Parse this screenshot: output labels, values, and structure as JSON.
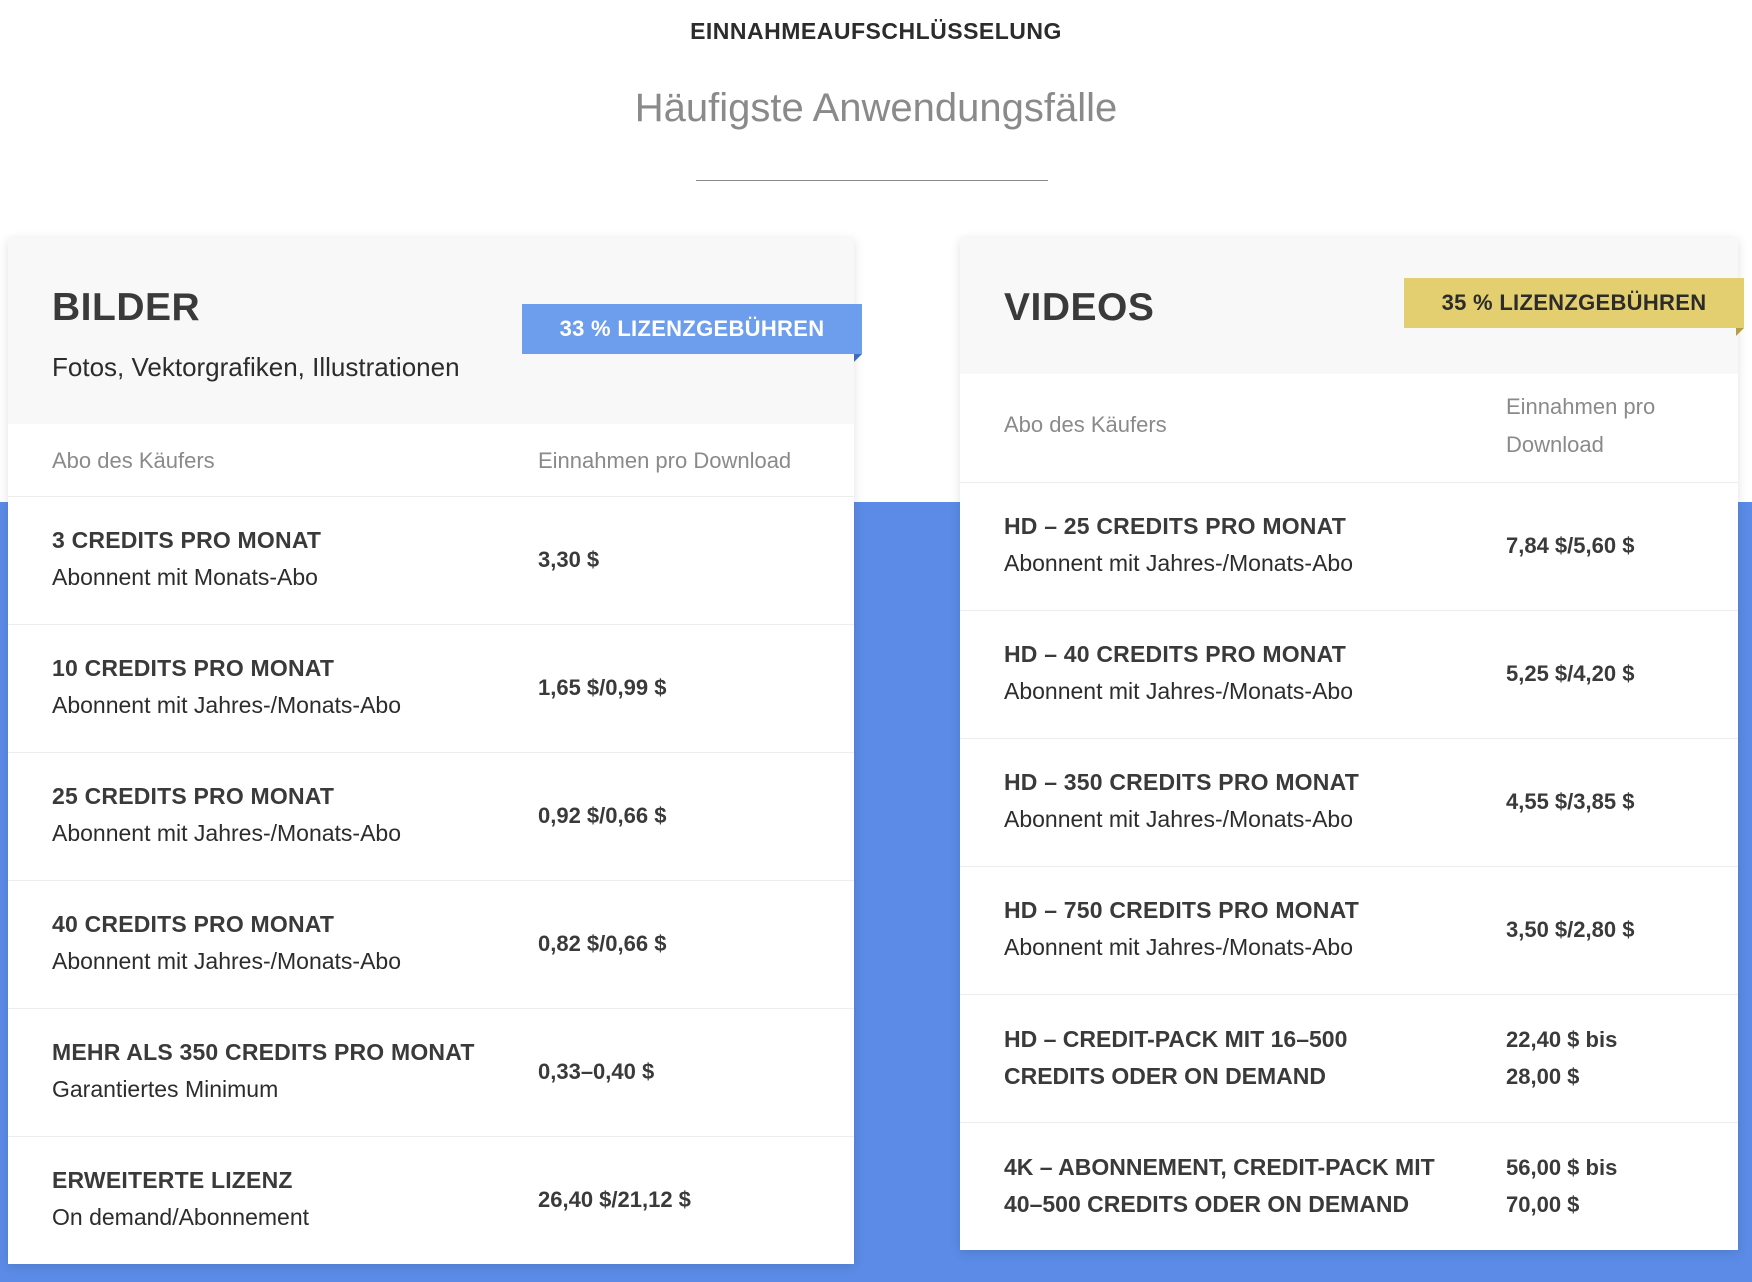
{
  "header": {
    "eyebrow": "EINNAHMEAUFSCHLÜSSELUNG",
    "title": "Häufigste Anwendungsfälle"
  },
  "colors": {
    "band": "#5b8be6",
    "badge_images": "#6d9eed",
    "badge_videos": "#e3cf6f"
  },
  "images": {
    "title": "BILDER",
    "subtitle": "Fotos, Vektorgrafiken, Illustrationen",
    "badge": "33 % LIZENZGEBÜHREN",
    "col_plan": "Abo des Käufers",
    "col_earnings": "Einnahmen pro Download",
    "rows": [
      {
        "name": "3 CREDITS PRO MONAT",
        "desc": "Abonnent mit Monats-Abo",
        "value": "3,30 $"
      },
      {
        "name": "10 CREDITS PRO MONAT",
        "desc": "Abonnent mit Jahres-/Monats-Abo",
        "value": "1,65 $/0,99 $"
      },
      {
        "name": "25 CREDITS PRO MONAT",
        "desc": "Abonnent mit Jahres-/Monats-Abo",
        "value": "0,92 $/0,66 $"
      },
      {
        "name": "40 CREDITS PRO MONAT",
        "desc": "Abonnent mit Jahres-/Monats-Abo",
        "value": "0,82 $/0,66 $"
      },
      {
        "name": "MEHR ALS 350 CREDITS PRO MONAT",
        "desc": "Garantiertes Minimum",
        "value": "0,33–0,40 $"
      },
      {
        "name": "ERWEITERTE LIZENZ",
        "desc": "On demand/Abonnement",
        "value": "26,40 $/21,12 $"
      }
    ]
  },
  "videos": {
    "title": "VIDEOS",
    "badge": "35 % LIZENZGEBÜHREN",
    "col_plan": "Abo des Käufers",
    "col_earnings_1": "Einnahmen pro",
    "col_earnings_2": "Download",
    "rows": [
      {
        "name": "HD – 25 CREDITS PRO MONAT",
        "desc": "Abonnent mit Jahres-/Monats-Abo",
        "value": "7,84 $/5,60 $"
      },
      {
        "name": "HD – 40 CREDITS PRO MONAT",
        "desc": "Abonnent mit Jahres-/Monats-Abo",
        "value": "5,25 $/4,20 $"
      },
      {
        "name": "HD – 350 CREDITS PRO MONAT",
        "desc": "Abonnent mit Jahres-/Monats-Abo",
        "value": "4,55 $/3,85 $"
      },
      {
        "name": "HD – 750 CREDITS PRO MONAT",
        "desc": "Abonnent mit Jahres-/Monats-Abo",
        "value": "3,50 $/2,80 $"
      }
    ],
    "pack_rows": [
      {
        "name_1": "HD – CREDIT-PACK MIT 16–500",
        "name_2": "CREDITS ODER ON DEMAND",
        "value_1": "22,40 $ bis",
        "value_2": "28,00 $"
      },
      {
        "name_1": "4K – ABONNEMENT, CREDIT-PACK MIT",
        "name_2": "40–500 CREDITS ODER ON DEMAND",
        "value_1": "56,00 $ bis",
        "value_2": "70,00 $"
      }
    ]
  }
}
